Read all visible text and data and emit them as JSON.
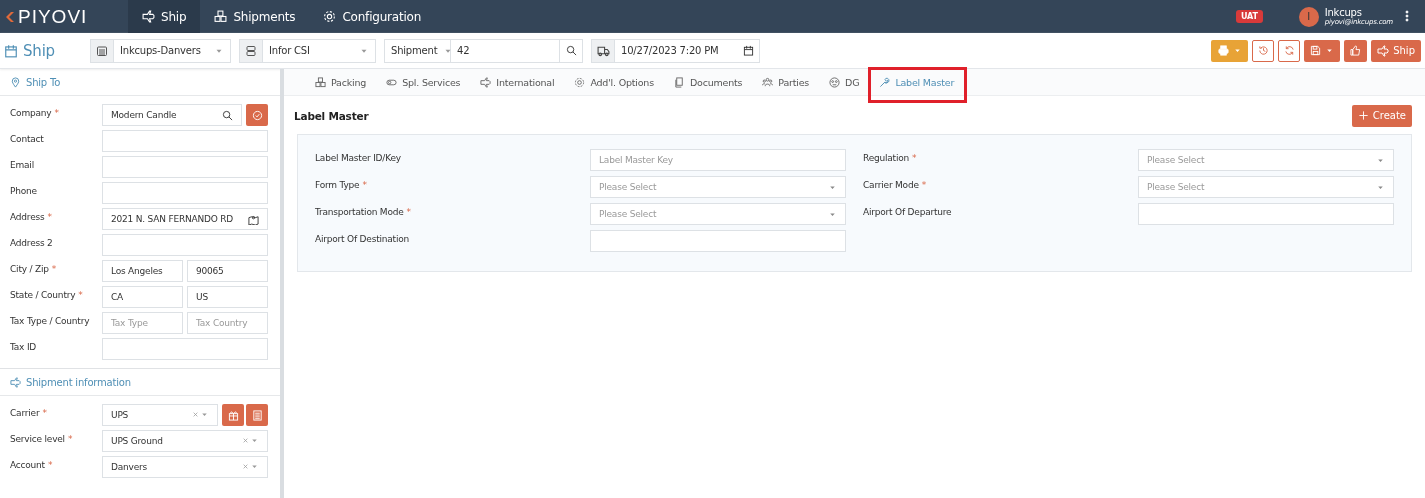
{
  "topbar": {
    "logo": "PIYOVI",
    "nav": [
      {
        "label": "Ship",
        "selected": true
      },
      {
        "label": "Shipments",
        "selected": false
      },
      {
        "label": "Configuration",
        "selected": false
      }
    ],
    "env_badge": "UAT",
    "user": {
      "initial": "I",
      "name": "Inkcups",
      "email": "piyovi@inkcups.com"
    }
  },
  "toolbar": {
    "title": "Ship",
    "location": "Inkcups-Danvers",
    "erp": "Infor CSI",
    "reference_type": "Shipment",
    "reference_value": "42",
    "date": "10/27/2023 7:20 PM",
    "ship_button": "Ship"
  },
  "ship_to": {
    "title": "Ship To",
    "fields": [
      {
        "kind": "search",
        "label": "Company",
        "required_mark": "*",
        "value": "Modern Candle"
      },
      {
        "kind": "text",
        "label": "Contact"
      },
      {
        "kind": "text",
        "label": "Email"
      },
      {
        "kind": "text",
        "label": "Phone"
      },
      {
        "kind": "map",
        "label": "Address",
        "required_mark": "*",
        "value": "2021 N. SAN FERNANDO RD"
      },
      {
        "kind": "text",
        "label": "Address 2"
      },
      {
        "kind": "pair",
        "label": "City / Zip",
        "required_mark": "*",
        "parts": [
          {
            "value": "Los Angeles"
          },
          {
            "value": "90065"
          }
        ]
      },
      {
        "kind": "pair",
        "label": "State / Country",
        "required_mark": "*",
        "parts": [
          {
            "value": "CA"
          },
          {
            "value": "US"
          }
        ]
      },
      {
        "kind": "pair",
        "label": "Tax Type / Country",
        "parts": [
          {
            "placeholder": "Tax Type"
          },
          {
            "placeholder": "Tax Country"
          }
        ]
      },
      {
        "kind": "text",
        "label": "Tax ID"
      }
    ]
  },
  "shipment_info": {
    "title": "Shipment information",
    "fields": [
      {
        "kind": "carrier",
        "label": "Carrier",
        "required_mark": "*",
        "value": "UPS"
      },
      {
        "kind": "select",
        "label": "Service level",
        "required_mark": "*",
        "value": "UPS Ground"
      },
      {
        "kind": "select",
        "label": "Account",
        "required_mark": "*",
        "value": "Danvers"
      }
    ]
  },
  "tabs": [
    {
      "label": "Packing",
      "selected": false,
      "highlighted": false
    },
    {
      "label": "Spl. Services",
      "selected": false,
      "highlighted": false
    },
    {
      "label": "International",
      "selected": false,
      "highlighted": false
    },
    {
      "label": "Add'l. Options",
      "selected": false,
      "highlighted": false
    },
    {
      "label": "Documents",
      "selected": false,
      "highlighted": false
    },
    {
      "label": "Parties",
      "selected": false,
      "highlighted": false
    },
    {
      "label": "DG",
      "selected": false,
      "highlighted": false
    },
    {
      "label": "Label Master",
      "selected": true,
      "highlighted": true
    }
  ],
  "panel": {
    "title": "Label Master",
    "create_button": "Create",
    "fields": [
      {
        "kind": "text",
        "label": "Label Master ID/Key",
        "placeholder": "Label Master Key"
      },
      {
        "kind": "select",
        "label": "Regulation",
        "required_mark": "*",
        "placeholder": "Please Select"
      },
      {
        "kind": "select",
        "label": "Form Type",
        "required_mark": "*",
        "placeholder": "Please Select"
      },
      {
        "kind": "select",
        "label": "Carrier Mode",
        "required_mark": "*",
        "placeholder": "Please Select"
      },
      {
        "kind": "select",
        "label": "Transportation Mode",
        "required_mark": "*",
        "placeholder": "Please Select"
      },
      {
        "kind": "text",
        "label": "Airport Of Departure"
      },
      {
        "kind": "text",
        "label": "Airport Of Destination"
      }
    ]
  }
}
